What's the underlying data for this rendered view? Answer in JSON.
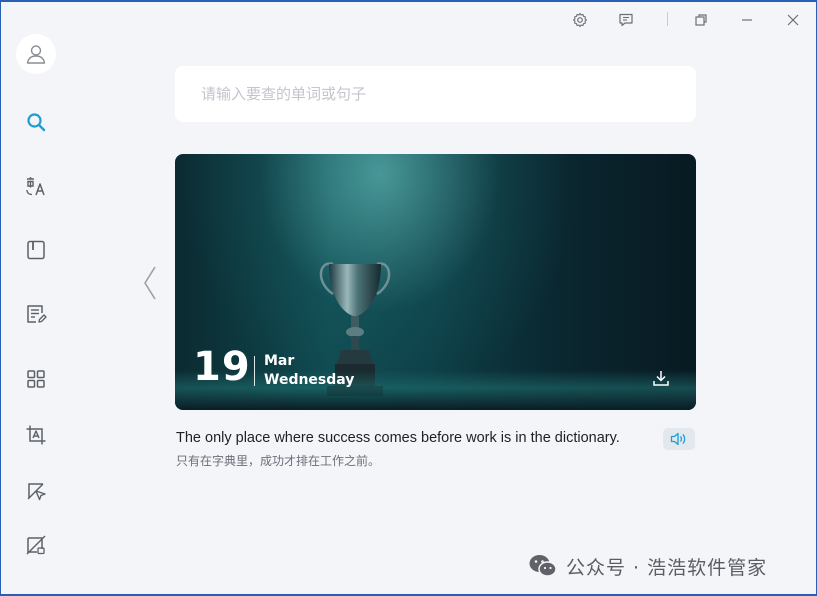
{
  "titlebar": {
    "buttons": [
      "settings-icon",
      "feedback-icon",
      "restore-icon",
      "minimize-icon",
      "close-icon"
    ]
  },
  "sidebar": {
    "items": [
      {
        "name": "search",
        "icon": "search-icon",
        "active": true
      },
      {
        "name": "translate",
        "icon": "translate-icon",
        "active": false
      },
      {
        "name": "wordbook",
        "icon": "book-icon",
        "active": false
      },
      {
        "name": "notes",
        "icon": "note-edit-icon",
        "active": false
      },
      {
        "name": "apps",
        "icon": "grid-icon",
        "active": false
      },
      {
        "name": "screenshot-translate",
        "icon": "crop-text-icon",
        "active": false
      },
      {
        "name": "pointer-translate",
        "icon": "pointer-icon",
        "active": false
      },
      {
        "name": "disable",
        "icon": "slash-icon",
        "active": false
      }
    ]
  },
  "search": {
    "placeholder": "请输入要查的单词或句子"
  },
  "daily": {
    "day": "19",
    "month": "Mar",
    "weekday": "Wednesday",
    "sentence_en": "The only place where success comes before work is in the dictionary.",
    "sentence_cn": "只有在字典里，成功才排在工作之前。"
  },
  "watermark": {
    "text": "公众号 · 浩浩软件管家",
    "icon": "wechat-icon"
  },
  "colors": {
    "accent": "#1a9fd9",
    "icon_gray": "#5b6068",
    "background": "#f4f5f9"
  }
}
